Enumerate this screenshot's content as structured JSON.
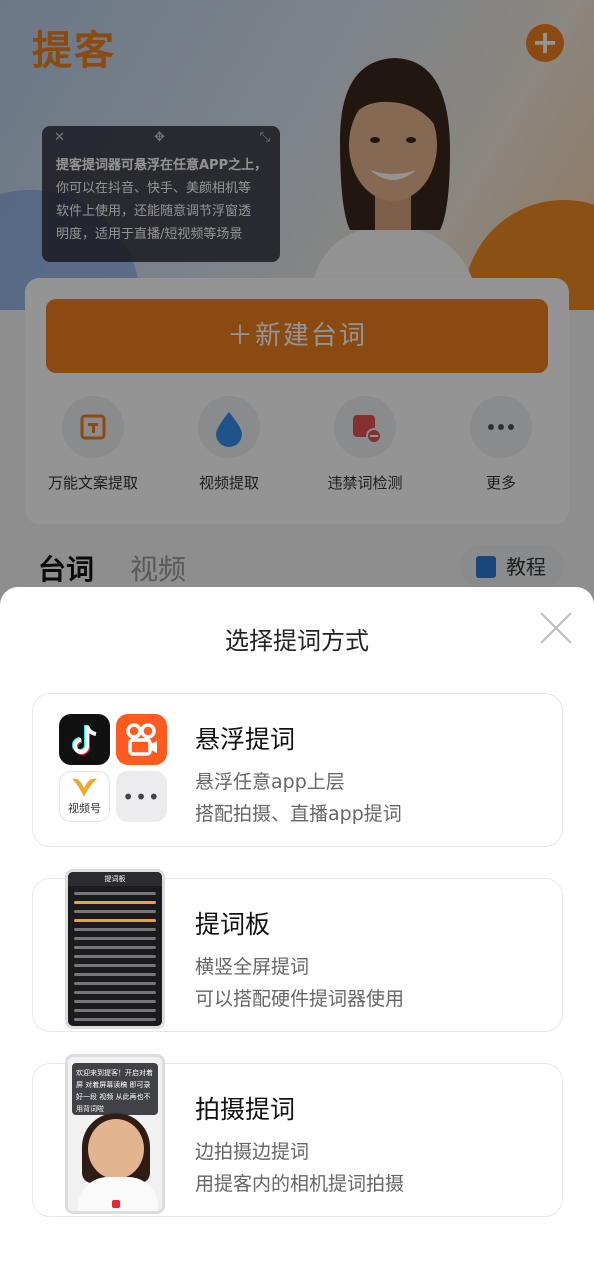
{
  "brand": {
    "logo_text": "提客"
  },
  "hero": {
    "tip_lines": [
      "提客提词器可悬浮在任意APP之上，",
      "你可以在抖音、快手、美颜相机等",
      "软件上使用，还能随意调节浮窗透",
      "明度，适用于直播/短视频等场景"
    ],
    "tip_controls": {
      "close": "✕",
      "move": "✥",
      "resize": "⤡"
    }
  },
  "panel": {
    "new_button": "新建台词",
    "tools": [
      {
        "label": "万能文案提取",
        "icon": "scan-text-icon"
      },
      {
        "label": "视频提取",
        "icon": "water-drop-icon"
      },
      {
        "label": "违禁词检测",
        "icon": "prohibited-check-icon"
      },
      {
        "label": "更多",
        "icon": "more-dots-icon"
      }
    ]
  },
  "tabs": {
    "active": "台词",
    "other": "视频",
    "tutorial": "教程"
  },
  "sheet": {
    "title": "选择提词方式",
    "options": [
      {
        "title": "悬浮提词",
        "line1": "悬浮任意app上层",
        "line2": "搭配拍摄、直播app提词",
        "app_label": "视频号"
      },
      {
        "title": "提词板",
        "line1": "横竖全屏提词",
        "line2": "可以搭配硬件提词器使用",
        "preview_title": "提词板"
      },
      {
        "title": "拍摄提词",
        "line1": "边拍摄边提词",
        "line2": "用提客内的相机提词拍摄",
        "preview_caption": "欢迎来到提客！开启对着屏 对着屏幕读稿 即可录好一段 视频 从此再也不用背词啦"
      }
    ]
  },
  "colors": {
    "accent": "#f0801f",
    "dim_overlay": "rgba(0,0,0,0.42)"
  }
}
